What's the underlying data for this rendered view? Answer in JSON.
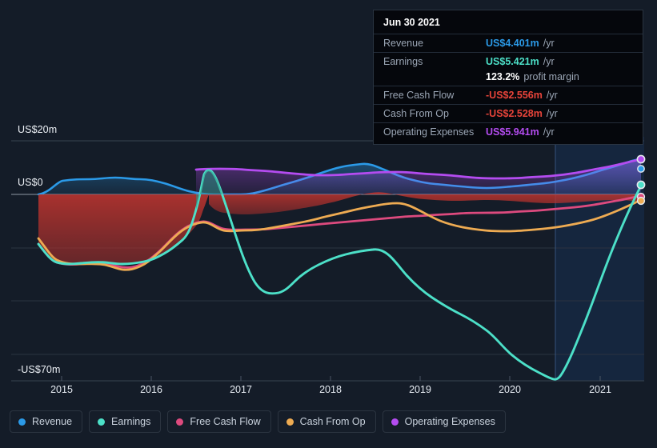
{
  "tooltip": {
    "date": "Jun 30 2021",
    "rows": [
      {
        "label": "Revenue",
        "value": "US$4.401m",
        "suffix": "/yr",
        "color": "#2b9ae8"
      },
      {
        "label": "Earnings",
        "value": "US$5.421m",
        "suffix": "/yr",
        "color": "#4ce0c8"
      },
      {
        "label": "",
        "value": "123.2%",
        "suffix": "profit margin",
        "color": "#ffffff"
      },
      {
        "label": "Free Cash Flow",
        "value": "-US$2.556m",
        "suffix": "/yr",
        "color": "#e8443a"
      },
      {
        "label": "Cash From Op",
        "value": "-US$2.528m",
        "suffix": "/yr",
        "color": "#e8443a"
      },
      {
        "label": "Operating Expenses",
        "value": "US$5.941m",
        "suffix": "/yr",
        "color": "#b44cf0"
      }
    ]
  },
  "legend": {
    "items": [
      {
        "label": "Revenue",
        "color": "#2b9ae8"
      },
      {
        "label": "Earnings",
        "color": "#4ce0c8"
      },
      {
        "label": "Free Cash Flow",
        "color": "#dd4a7e"
      },
      {
        "label": "Cash From Op",
        "color": "#eeab52"
      },
      {
        "label": "Operating Expenses",
        "color": "#b44cf0"
      }
    ]
  },
  "chart_data": {
    "type": "line",
    "title": "",
    "xlabel": "",
    "ylabel": "",
    "currency": "USD",
    "unit": "millions",
    "ylim": [
      -70,
      20
    ],
    "y_ticks": [
      20,
      0,
      -70
    ],
    "y_tick_labels": [
      "US$20m",
      "US$0",
      "-US$70m"
    ],
    "gridlines_y": [
      20,
      0,
      -20,
      -40,
      -60,
      -70
    ],
    "grid": true,
    "legend_position": "bottom",
    "x_ticks": [
      2015,
      2016,
      2017,
      2018,
      2019,
      2020,
      2021
    ],
    "x_tick_labels": [
      "2015",
      "2016",
      "2017",
      "2018",
      "2019",
      "2020",
      "2021"
    ],
    "xlim": [
      2014.75,
      2021.5
    ],
    "forecast_start": 2020.5,
    "x": [
      2014.75,
      2015.0,
      2015.25,
      2015.5,
      2015.75,
      2016.0,
      2016.25,
      2016.5,
      2016.75,
      2017.0,
      2017.25,
      2017.5,
      2017.75,
      2018.0,
      2018.25,
      2018.5,
      2018.75,
      2019.0,
      2019.25,
      2019.5,
      2019.75,
      2020.0,
      2020.25,
      2020.5,
      2020.75,
      2021.0,
      2021.25,
      2021.5
    ],
    "series": [
      {
        "name": "Revenue",
        "color": "#2b9ae8",
        "values": [
          0.0,
          1.6,
          2.2,
          2.2,
          2.4,
          2.6,
          2.1,
          1.2,
          0.3,
          0.1,
          0.4,
          1.4,
          2.3,
          3.0,
          3.8,
          4.6,
          4.0,
          3.3,
          2.9,
          2.5,
          2.1,
          1.7,
          1.6,
          1.8,
          2.2,
          2.8,
          3.6,
          4.4
        ]
      },
      {
        "name": "Earnings",
        "color": "#4ce0c8",
        "values": [
          -18.5,
          -24.0,
          -26.0,
          -25.5,
          -24.5,
          -25.0,
          -15.0,
          1.5,
          -5.0,
          -22.0,
          -34.5,
          -36.5,
          -33.5,
          -28.0,
          -25.0,
          -23.0,
          -27.0,
          -33.0,
          -39.0,
          -45.0,
          -55.0,
          -60.0,
          -64.0,
          -67.5,
          -68.5,
          -45.0,
          -18.0,
          5.4
        ]
      },
      {
        "name": "Free Cash Flow",
        "color": "#dd4a7e",
        "values": [
          -18.5,
          -24.0,
          -26.5,
          -26.0,
          -25.0,
          -26.5,
          -22.0,
          -18.5,
          -18.5,
          -13.0,
          -12.5,
          -12.5,
          -12.0,
          -11.0,
          -10.5,
          -9.5,
          -8.0,
          -7.0,
          -6.5,
          -6.0,
          -5.8,
          -5.5,
          -5.2,
          -5.0,
          -4.5,
          -4.0,
          -3.2,
          -2.6
        ]
      },
      {
        "name": "Cash From Op",
        "color": "#eeab52",
        "values": [
          -16.5,
          -22.5,
          -25.5,
          -25.5,
          -24.5,
          -27.0,
          -22.5,
          -18.5,
          -18.0,
          -13.0,
          -12.5,
          -12.0,
          -11.0,
          -9.5,
          -8.0,
          -6.5,
          -7.5,
          -9.0,
          -10.0,
          -10.8,
          -11.2,
          -11.3,
          -11.0,
          -10.5,
          -9.5,
          -8.0,
          -5.5,
          -2.5
        ]
      },
      {
        "name": "Operating Expenses",
        "color": "#b44cf0",
        "values": [
          null,
          null,
          null,
          null,
          null,
          null,
          null,
          3.5,
          3.6,
          3.6,
          3.6,
          3.5,
          3.4,
          3.4,
          3.5,
          3.6,
          3.6,
          3.5,
          3.4,
          3.3,
          3.2,
          3.1,
          3.2,
          3.4,
          3.6,
          4.2,
          5.0,
          5.9
        ]
      }
    ]
  }
}
